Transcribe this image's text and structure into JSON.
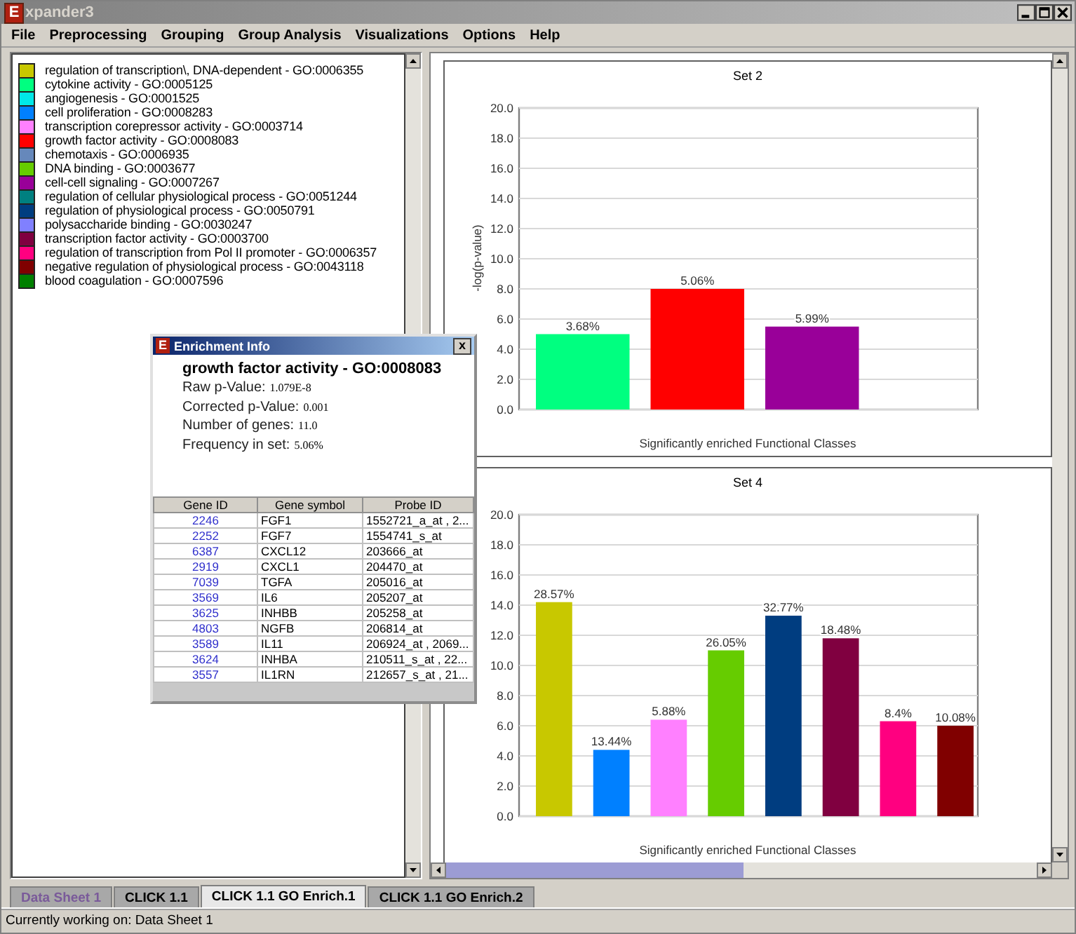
{
  "window": {
    "icon": "E",
    "title": "xpander3"
  },
  "menu": [
    "File",
    "Preprocessing",
    "Grouping",
    "Group Analysis",
    "Visualizations",
    "Options",
    "Help"
  ],
  "legend": [
    {
      "label": "regulation of transcription\\, DNA-dependent - GO:0006355",
      "color": "#c8c800"
    },
    {
      "label": "cytokine activity - GO:0005125",
      "color": "#00ff80"
    },
    {
      "label": "angiogenesis - GO:0001525",
      "color": "#00e8e8"
    },
    {
      "label": "cell proliferation - GO:0008283",
      "color": "#0080ff"
    },
    {
      "label": "transcription corepressor activity - GO:0003714",
      "color": "#ff80ff"
    },
    {
      "label": "growth factor activity - GO:0008083",
      "color": "#ff0000"
    },
    {
      "label": "chemotaxis - GO:0006935",
      "color": "#6688bb"
    },
    {
      "label": "DNA binding - GO:0003677",
      "color": "#66cc00"
    },
    {
      "label": "cell-cell signaling - GO:0007267",
      "color": "#990099"
    },
    {
      "label": "regulation of cellular physiological process - GO:0051244",
      "color": "#008080"
    },
    {
      "label": "regulation of physiological process - GO:0050791",
      "color": "#003d80"
    },
    {
      "label": "polysaccharide binding - GO:0030247",
      "color": "#8080ff"
    },
    {
      "label": "transcription factor activity - GO:0003700",
      "color": "#800040"
    },
    {
      "label": "regulation of transcription from Pol II promoter - GO:0006357",
      "color": "#ff0080"
    },
    {
      "label": "negative regulation of physiological process - GO:0043118",
      "color": "#800000"
    },
    {
      "label": "blood coagulation - GO:0007596",
      "color": "#008000"
    }
  ],
  "charts": [
    {
      "chart_data": {
        "type": "bar",
        "title": "Set 2",
        "xlabel": "Significantly enriched Functional Classes",
        "ylabel": "-log(p-value)",
        "grid": true,
        "ylim": [
          0,
          20
        ],
        "yticks": [
          {
            "value": 0,
            "label": "0.0"
          },
          {
            "value": 2,
            "label": "2.0"
          },
          {
            "value": 4,
            "label": "4.0"
          },
          {
            "value": 6,
            "label": "6.0"
          },
          {
            "value": 8,
            "label": "8.0"
          },
          {
            "value": 10,
            "label": "10.0"
          },
          {
            "value": 12,
            "label": "12.0"
          },
          {
            "value": 14,
            "label": "14.0"
          },
          {
            "value": 16,
            "label": "16.0"
          },
          {
            "value": 18,
            "label": "18.0"
          },
          {
            "value": 20,
            "label": "20.0"
          }
        ],
        "series": [
          {
            "color": "#00ff80",
            "values": [
              5.0
            ]
          },
          {
            "color": "#ff0000",
            "values": [
              8.0
            ]
          },
          {
            "color": "#990099",
            "values": [
              5.5
            ]
          }
        ],
        "value_labels": [
          "3.68%",
          "5.06%",
          "5.99%"
        ]
      }
    },
    {
      "chart_data": {
        "type": "bar",
        "title": "Set 4",
        "xlabel": "Significantly enriched Functional Classes",
        "grid": true,
        "ylim": [
          0,
          20
        ],
        "yticks": [
          {
            "value": 0,
            "label": "0.0"
          },
          {
            "value": 2,
            "label": "2.0"
          },
          {
            "value": 4,
            "label": "4.0"
          },
          {
            "value": 6,
            "label": "6.0"
          },
          {
            "value": 8,
            "label": "8.0"
          },
          {
            "value": 10,
            "label": "10.0"
          },
          {
            "value": 12,
            "label": "12.0"
          },
          {
            "value": 14,
            "label": "14.0"
          },
          {
            "value": 16,
            "label": "16.0"
          },
          {
            "value": 18,
            "label": "18.0"
          },
          {
            "value": 20,
            "label": "20.0"
          }
        ],
        "series": [
          {
            "color": "#c8c800",
            "values": [
              14.2
            ]
          },
          {
            "color": "#0080ff",
            "values": [
              4.4
            ]
          },
          {
            "color": "#ff80ff",
            "values": [
              6.4
            ]
          },
          {
            "color": "#66cc00",
            "values": [
              11.0
            ]
          },
          {
            "color": "#003d80",
            "values": [
              13.3
            ]
          },
          {
            "color": "#800040",
            "values": [
              11.8
            ]
          },
          {
            "color": "#ff0080",
            "values": [
              6.3
            ]
          },
          {
            "color": "#800000",
            "values": [
              6.0
            ]
          }
        ],
        "value_labels": [
          "28.57%",
          "13.44%",
          "5.88%",
          "26.05%",
          "32.77%",
          "18.48%",
          "8.4%",
          "10.08%"
        ]
      }
    }
  ],
  "dialog": {
    "icon": "E",
    "title": "Enrichment Info",
    "close": "x",
    "heading": "growth factor activity - GO:0008083",
    "fields": [
      {
        "label": "Raw p-Value:",
        "value": "1.079E-8"
      },
      {
        "label": "Corrected p-Value:",
        "value": "0.001"
      },
      {
        "label": "Number of genes:",
        "value": "11.0"
      },
      {
        "label": "Frequency in set:",
        "value": "5.06%"
      }
    ],
    "table": {
      "columns": [
        "Gene ID",
        "Gene symbol",
        "Probe ID"
      ],
      "rows": [
        [
          "2246",
          "FGF1",
          "1552721_a_at , 2..."
        ],
        [
          "2252",
          "FGF7",
          "1554741_s_at"
        ],
        [
          "6387",
          "CXCL12",
          "203666_at"
        ],
        [
          "2919",
          "CXCL1",
          "204470_at"
        ],
        [
          "7039",
          "TGFA",
          "205016_at"
        ],
        [
          "3569",
          "IL6",
          "205207_at"
        ],
        [
          "3625",
          "INHBB",
          "205258_at"
        ],
        [
          "4803",
          "NGFB",
          "206814_at"
        ],
        [
          "3589",
          "IL11",
          "206924_at , 2069..."
        ],
        [
          "3624",
          "INHBA",
          "210511_s_at , 22..."
        ],
        [
          "3557",
          "IL1RN",
          "212657_s_at , 21..."
        ]
      ]
    }
  },
  "tabs": [
    {
      "label": "Data Sheet 1",
      "kind": "sheet",
      "selected": false
    },
    {
      "label": "CLICK 1.1",
      "kind": "result",
      "selected": false
    },
    {
      "label": "CLICK 1.1 GO Enrich.1",
      "kind": "result",
      "selected": true
    },
    {
      "label": "CLICK 1.1 GO Enrich.2",
      "kind": "result",
      "selected": false
    }
  ],
  "status_bar": "Currently working on: Data Sheet 1"
}
